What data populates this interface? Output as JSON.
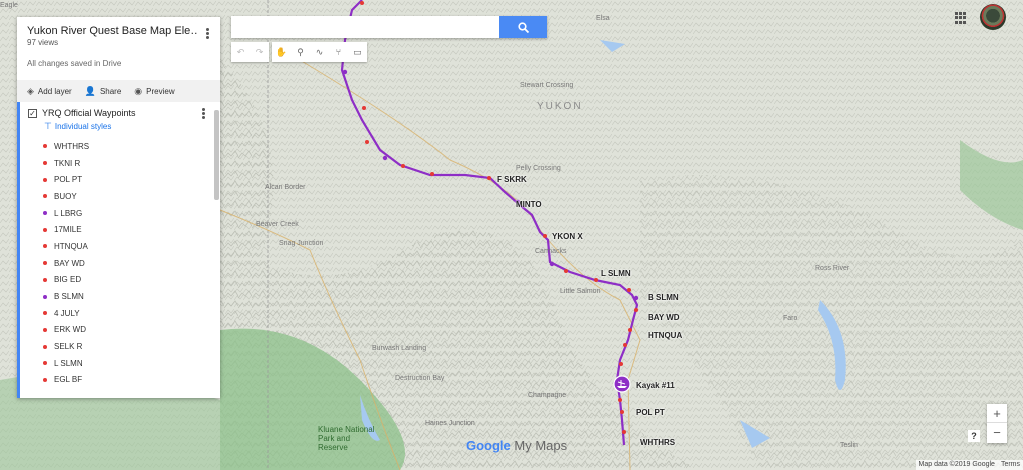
{
  "map": {
    "region_label": "YUKON",
    "place_labels": [
      "Eagle",
      "Elsa",
      "Stewart Crossing",
      "Pelly Crossing",
      "Beaver Creek",
      "Snag Junction",
      "Alcan Border",
      "Burwash Landing",
      "Destruction Bay",
      "Haines Junction",
      "Carmacks",
      "Little Salmon",
      "Ross River",
      "Faro",
      "Teslin",
      "Kluane National Park and Reserve",
      "Champagne"
    ],
    "route_labels": {
      "fskrk": "F SKRK",
      "minto": "MINTO",
      "ykonx": "YKON X",
      "lslmn": "L SLMN",
      "bslmn": "B SLMN",
      "baywd": "BAY WD",
      "htnqua": "HTNQUA",
      "kayak": "Kayak #11",
      "polpt": "POL PT",
      "whthrs": "WHTHRS"
    },
    "colors": {
      "route": "#8e2ec6",
      "waypoint": "#e53935",
      "kayak_marker": "#8e2ec6",
      "water": "#a6c9f0",
      "park": "#8cc08a"
    }
  },
  "panel": {
    "title": "Yukon River Quest Base Map Ele…",
    "views": "97 views",
    "saved": "All changes saved in Drive",
    "tools": {
      "add_layer": "Add layer",
      "share": "Share",
      "preview": "Preview"
    },
    "layer": {
      "name": "YRQ Official Waypoints",
      "styles_link": "Individual styles",
      "checked": true,
      "items": [
        {
          "label": "WHTHRS",
          "color": "#e53935"
        },
        {
          "label": "TKNI R",
          "color": "#e53935"
        },
        {
          "label": "POL PT",
          "color": "#e53935"
        },
        {
          "label": "BUOY",
          "color": "#e53935"
        },
        {
          "label": "L LBRG",
          "color": "#8e2ec6"
        },
        {
          "label": "17MILE",
          "color": "#e53935"
        },
        {
          "label": "HTNQUA",
          "color": "#e53935"
        },
        {
          "label": "BAY WD",
          "color": "#e53935"
        },
        {
          "label": "BIG ED",
          "color": "#e53935"
        },
        {
          "label": "B SLMN",
          "color": "#8e2ec6"
        },
        {
          "label": "4 JULY",
          "color": "#e53935"
        },
        {
          "label": "ERK WD",
          "color": "#e53935"
        },
        {
          "label": "SELK R",
          "color": "#e53935"
        },
        {
          "label": "L SLMN",
          "color": "#e53935"
        },
        {
          "label": "EGL BF",
          "color": "#e53935"
        }
      ]
    }
  },
  "search": {
    "placeholder": "",
    "value": ""
  },
  "toolbar": {
    "icons": [
      "undo-icon",
      "redo-icon",
      "hand-icon",
      "marker-icon",
      "line-icon",
      "directions-icon",
      "ruler-icon"
    ]
  },
  "zoom": {
    "in": "+",
    "out": "−"
  },
  "help": "?",
  "logo": {
    "google": "Google",
    "mymaps": "My Maps"
  },
  "attribution": {
    "data": "Map data ©2019 Google",
    "terms": "Terms"
  }
}
